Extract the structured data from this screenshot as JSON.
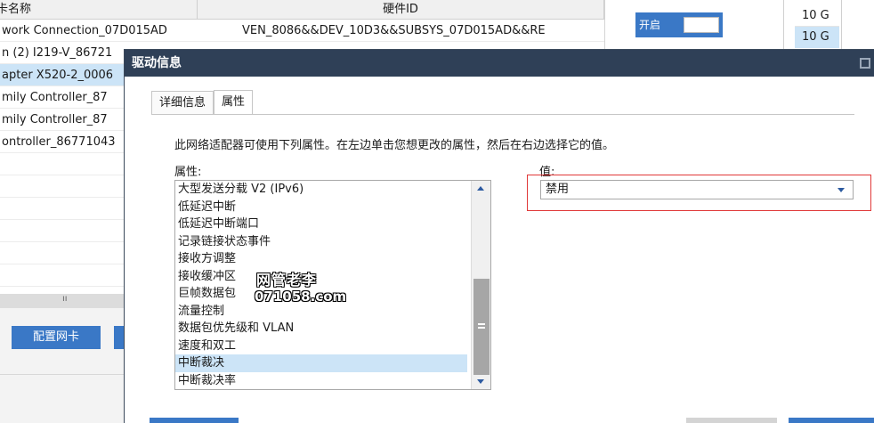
{
  "background": {
    "table": {
      "headers": [
        "卡名称",
        "硬件ID"
      ],
      "rows": [
        {
          "name": "work Connection_07D015AD",
          "hwid": "VEN_8086&&DEV_10D3&&SUBSYS_07D015AD&&RE"
        },
        {
          "name": "n (2) I219-V_86721",
          "hwid": ""
        },
        {
          "name": "apter X520-2_0006",
          "hwid": ""
        },
        {
          "name": "mily Controller_87",
          "hwid": ""
        },
        {
          "name": "mily Controller_87",
          "hwid": ""
        },
        {
          "name": "ontroller_86771043",
          "hwid": ""
        },
        {
          "name": "",
          "hwid": ""
        },
        {
          "name": "",
          "hwid": ""
        },
        {
          "name": "",
          "hwid": ""
        },
        {
          "name": "",
          "hwid": ""
        },
        {
          "name": "",
          "hwid": ""
        },
        {
          "name": "",
          "hwid": ""
        }
      ]
    },
    "scroll_grip": "ıı",
    "config_button": "配置网卡",
    "toggle_label": "开启",
    "speed_1": "10 G",
    "speed_2": "10 G"
  },
  "dialog": {
    "title": "驱动信息",
    "tabs": [
      {
        "label": "详细信息"
      },
      {
        "label": "属性"
      }
    ],
    "description": "此网络适配器可使用下列属性。在左边单击您想更改的属性，然后在右边选择它的值。",
    "property_label": "属性:",
    "value_label": "值:",
    "properties": [
      "大型发送分载 V2 (IPv6)",
      "低延迟中断",
      "低延迟中断端口",
      "记录链接状态事件",
      "接收方调整",
      "接收缓冲区",
      "巨帧数据包",
      "流量控制",
      "数据包优先级和 VLAN",
      "速度和双工",
      "中断裁决",
      "中断裁决率"
    ],
    "selected_property": "中断裁决",
    "value": "禁用"
  },
  "watermark": {
    "line1": "网管老李",
    "line2": "071058.com"
  }
}
